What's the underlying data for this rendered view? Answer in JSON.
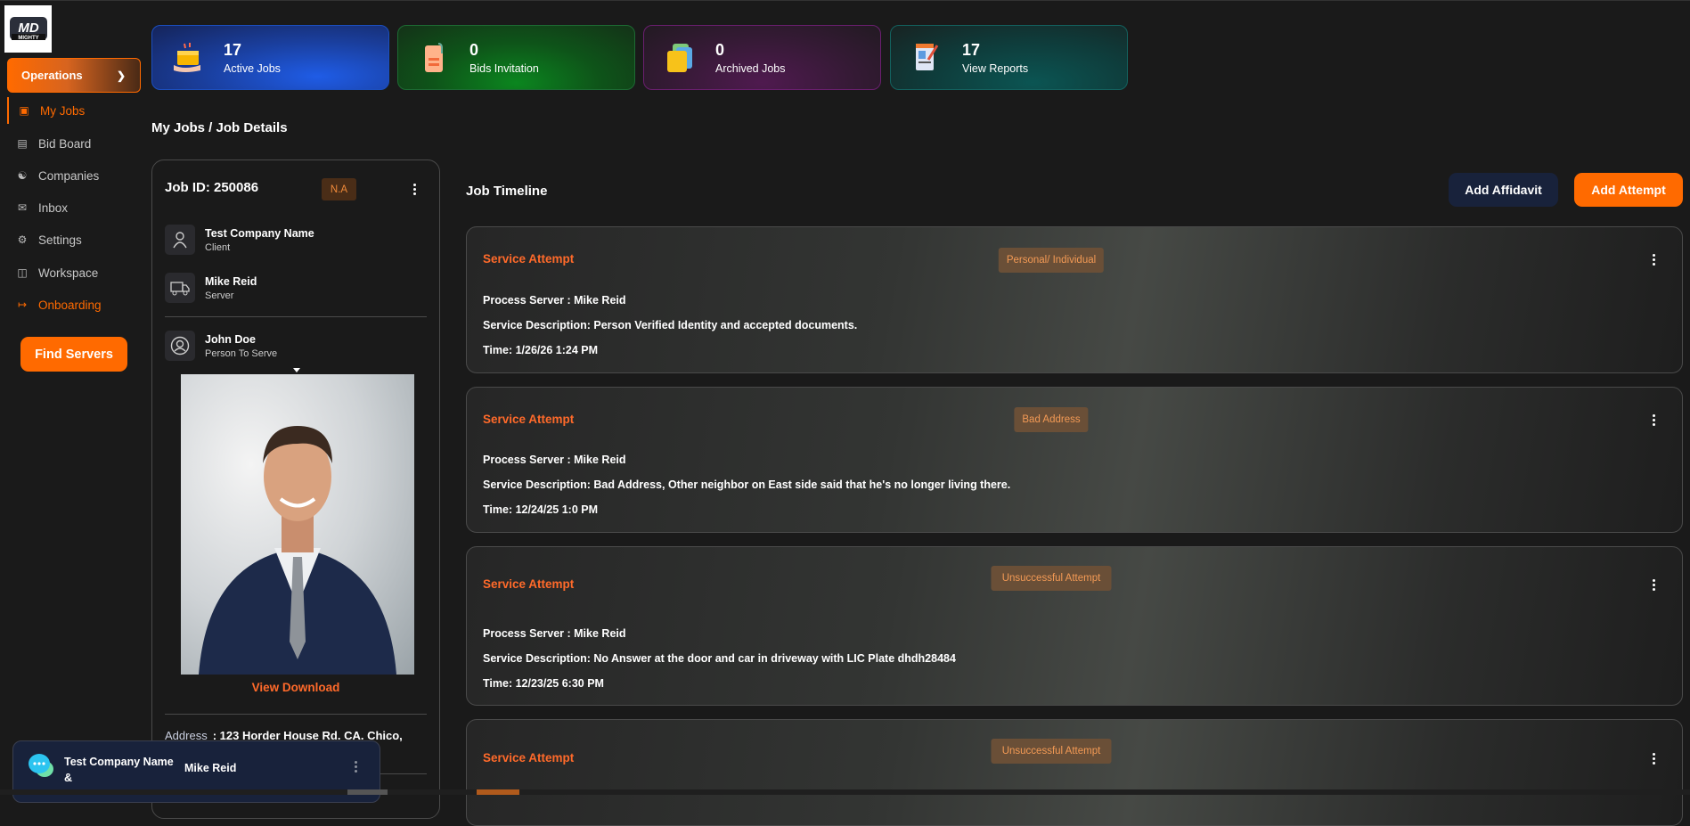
{
  "brand": {
    "logo_text": "MD MIGHTY"
  },
  "sidebar": {
    "section": "Operations",
    "items": [
      {
        "label": "My Jobs",
        "icon": "briefcase-icon"
      },
      {
        "label": "Bid Board",
        "icon": "clipboard-icon"
      },
      {
        "label": "Companies",
        "icon": "bank-icon"
      },
      {
        "label": "Inbox",
        "icon": "envelope-open-icon"
      },
      {
        "label": "Settings",
        "icon": "gear-icon"
      },
      {
        "label": "Workspace",
        "icon": "bag-icon"
      },
      {
        "label": "Onboarding",
        "icon": "arrow-right-bar-icon"
      }
    ],
    "find_servers": "Find Servers"
  },
  "stats": [
    {
      "value": "17",
      "label": "Active Jobs"
    },
    {
      "value": "0",
      "label": "Bids Invitation"
    },
    {
      "value": "0",
      "label": "Archived Jobs"
    },
    {
      "value": "17",
      "label": "View Reports"
    }
  ],
  "breadcrumb": "My Jobs / Job Details",
  "job": {
    "id": "Job ID: 250086",
    "status": "N.A",
    "client_name": "Test Company Name",
    "client_role": "Client",
    "server_name": "Mike Reid",
    "server_role": "Server",
    "person_name": "John Doe",
    "person_role": "Person To Serve",
    "view_download": "View Download",
    "address_label": "Address",
    "address_value": ": 123 Horder House Rd. CA. Chico,"
  },
  "timeline": {
    "title": "Job Timeline",
    "add_affidavit": "Add Affidavit",
    "add_attempt": "Add Attempt",
    "entries": [
      {
        "title": "Service Attempt",
        "badge": "Personal/ Individual",
        "server": "Process Server : Mike Reid",
        "description": "Service Description: Person Verified Identity and accepted documents.",
        "time": "Time: 1/26/26 1:24 PM"
      },
      {
        "title": "Service Attempt",
        "badge": "Bad Address",
        "server": "Process Server : Mike Reid",
        "description": "Service Description: Bad Address, Other neighbor on East side said that he's no longer living there.",
        "time": "Time: 12/24/25 1:0 PM"
      },
      {
        "title": "Service Attempt",
        "badge": "Unsuccessful Attempt",
        "server": "Process Server : Mike Reid",
        "description": "Service Description: No Answer at the door and car in driveway with LIC Plate dhdh28484",
        "time": "Time: 12/23/25 6:30 PM"
      },
      {
        "title": "Service Attempt",
        "badge": "Unsuccessful Attempt"
      }
    ]
  },
  "chat": {
    "company": "Test Company Name",
    "amp": "&",
    "server": "Mike Reid"
  },
  "colors": {
    "accent": "#ff6a00",
    "badge_bg": "#6a4f37",
    "badge_text": "#f39a55",
    "navy": "#18223b"
  }
}
